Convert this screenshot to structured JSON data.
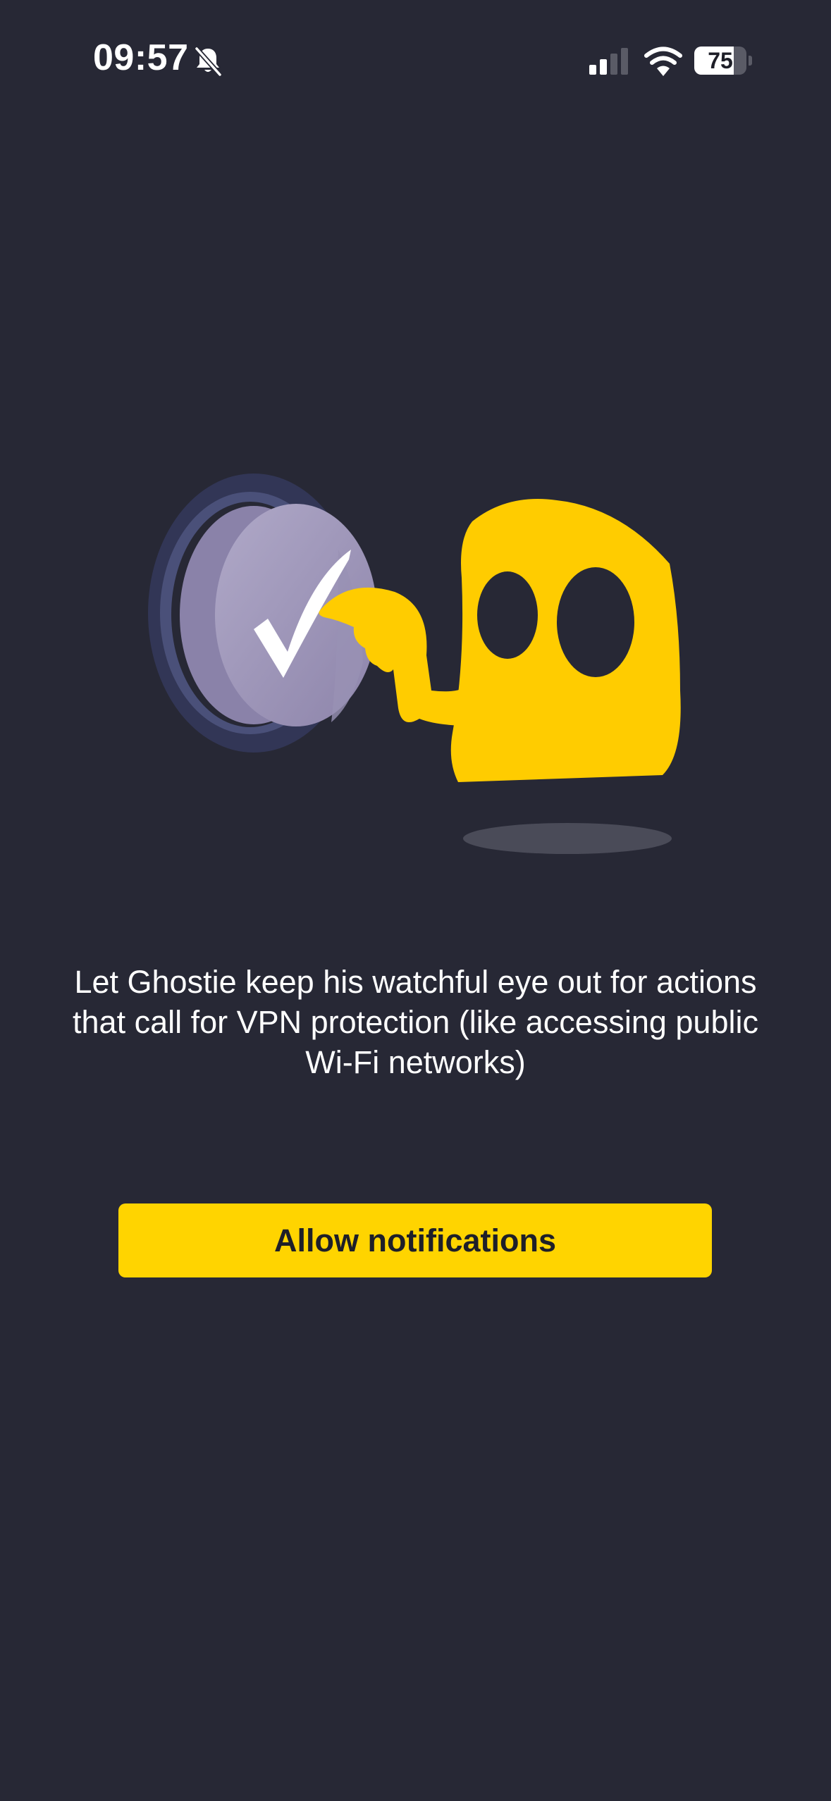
{
  "status_bar": {
    "time": "09:57",
    "silent_icon": "bell-slash-icon",
    "signal_icon": "cellular-signal-icon",
    "signal_bars_active": 2,
    "signal_bars_total": 4,
    "wifi_icon": "wifi-icon",
    "battery_level": "75",
    "battery_fraction": 0.75
  },
  "illustration": {
    "description_icons": [
      "checkmark-button-icon",
      "ghost-mascot-icon"
    ]
  },
  "onboarding": {
    "message": "Let Ghostie keep his watchful eye out for actions that call for VPN protection (like accessing public Wi-Fi networks)",
    "allow_button_label": "Allow notifications"
  },
  "colors": {
    "background": "#272835",
    "accent_yellow": "#ffd400",
    "button_text": "#1e1f29",
    "text": "#ffffff"
  }
}
